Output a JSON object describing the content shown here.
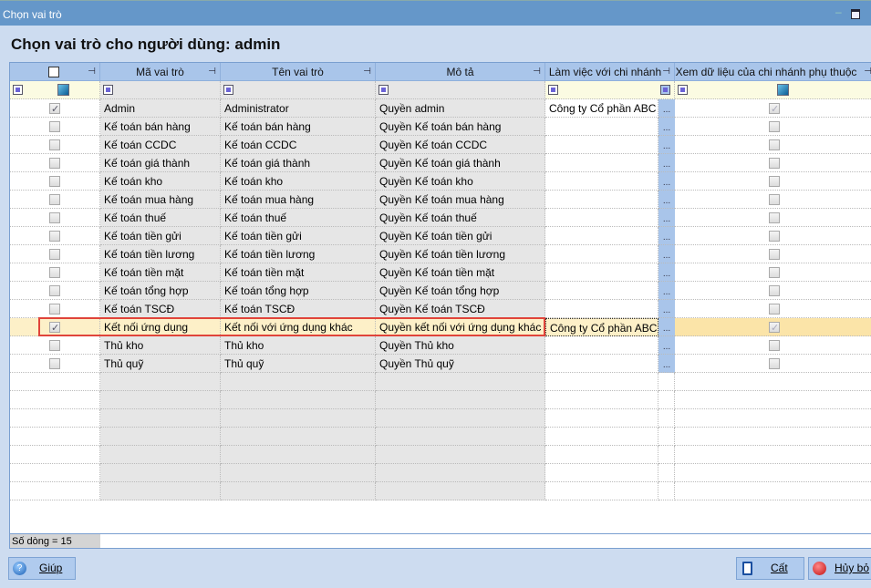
{
  "window": {
    "title": "Chọn vai trò"
  },
  "heading": "Chọn vai trò cho người dùng: admin",
  "columns": [
    "Mã vai trò",
    "Tên vai trò",
    "Mô tả",
    "Làm việc với chi nhánh",
    "Xem dữ liệu của chi nhánh phụ thuộc"
  ],
  "rows": [
    {
      "checked": true,
      "code": "Admin",
      "name": "Administrator",
      "desc": "Quyền admin",
      "branch": "Công ty Cổ phần ABC",
      "sub": true
    },
    {
      "checked": false,
      "code": "Kế toán bán hàng",
      "name": "Kế toán bán hàng",
      "desc": "Quyền Kế toán bán hàng",
      "branch": "",
      "sub": false
    },
    {
      "checked": false,
      "code": "Kế toán CCDC",
      "name": "Kế toán CCDC",
      "desc": "Quyền Kế toán CCDC",
      "branch": "",
      "sub": false
    },
    {
      "checked": false,
      "code": "Kế toán giá thành",
      "name": "Kế toán giá thành",
      "desc": "Quyền Kế toán giá thành",
      "branch": "",
      "sub": false
    },
    {
      "checked": false,
      "code": "Kế toán kho",
      "name": "Kế toán kho",
      "desc": "Quyền Kế toán kho",
      "branch": "",
      "sub": false
    },
    {
      "checked": false,
      "code": "Kế toán mua hàng",
      "name": "Kế toán mua hàng",
      "desc": "Quyền Kế toán mua hàng",
      "branch": "",
      "sub": false
    },
    {
      "checked": false,
      "code": "Kế toán thuế",
      "name": "Kế toán thuế",
      "desc": "Quyền Kế toán thuế",
      "branch": "",
      "sub": false
    },
    {
      "checked": false,
      "code": "Kế toán tiền gửi",
      "name": "Kế toán tiền gửi",
      "desc": "Quyền Kế toán tiền gửi",
      "branch": "",
      "sub": false
    },
    {
      "checked": false,
      "code": "Kế toán tiền lương",
      "name": "Kế toán tiền lương",
      "desc": "Quyền Kế toán tiền lương",
      "branch": "",
      "sub": false
    },
    {
      "checked": false,
      "code": "Kế toán tiền mặt",
      "name": "Kế toán tiền mặt",
      "desc": "Quyền Kế toán tiền mặt",
      "branch": "",
      "sub": false
    },
    {
      "checked": false,
      "code": "Kế toán tổng hợp",
      "name": "Kế toán tổng hợp",
      "desc": "Quyền Kế toán tổng hợp",
      "branch": "",
      "sub": false
    },
    {
      "checked": false,
      "code": "Kế toán TSCĐ",
      "name": "Kế toán TSCĐ",
      "desc": "Quyền Kế toán TSCĐ",
      "branch": "",
      "sub": false
    },
    {
      "checked": true,
      "code": "Kết nối ứng dụng",
      "name": "Kết nối với ứng dụng khác",
      "desc": "Quyền kết nối với ứng dụng khác",
      "branch": "Công ty Cổ phần ABC...",
      "sub": true,
      "selected": true
    },
    {
      "checked": false,
      "code": "Thủ kho",
      "name": "Thủ kho",
      "desc": "Quyền Thủ kho",
      "branch": "",
      "sub": false
    },
    {
      "checked": false,
      "code": "Thủ quỹ",
      "name": "Thủ quỹ",
      "desc": "Quyền Thủ quỹ",
      "branch": "",
      "sub": false
    }
  ],
  "ellipsis": "...",
  "footer": {
    "row_count": "Số dòng = 15"
  },
  "buttons": {
    "help": "Giúp",
    "save": "Cất",
    "cancel": "Hủy bỏ"
  }
}
